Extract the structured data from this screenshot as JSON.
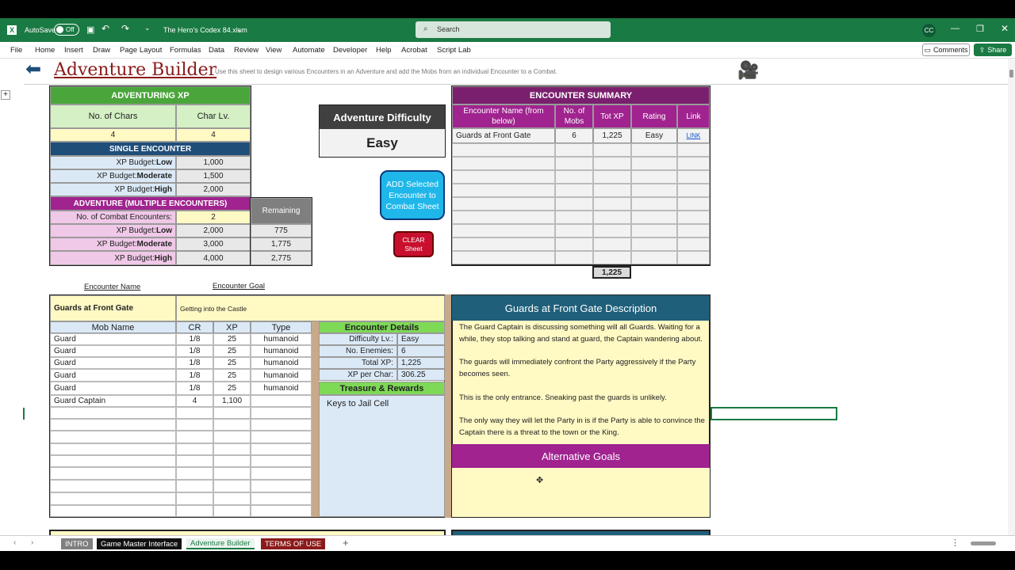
{
  "titlebar": {
    "autosave_label": "AutoSave",
    "toggle_state": "Off",
    "filename": "The Hero's Codex 84.xlsm",
    "search_placeholder": "Search",
    "user_initials": "CC"
  },
  "menu": [
    "File",
    "Home",
    "Insert",
    "Draw",
    "Page Layout",
    "Formulas",
    "Data",
    "Review",
    "View",
    "Automate",
    "Developer",
    "Help",
    "Acrobat",
    "Script Lab"
  ],
  "ribbon_buttons": {
    "comments": "Comments",
    "share": "Share"
  },
  "header": {
    "title": "Adventure Builder",
    "subtitle": "Use this sheet to design various Encounters in an Adventure and add the Mobs from an individual Encounter to a Combat."
  },
  "adventuring_xp": {
    "title": "ADVENTURING XP",
    "col1": "No. of Chars",
    "col2": "Char Lv.",
    "chars": "4",
    "lv": "4",
    "single_title": "SINGLE ENCOUNTER",
    "single": [
      {
        "prefix": "XP Budget: ",
        "level": "Low",
        "value": "1,000"
      },
      {
        "prefix": "XP Budget: ",
        "level": "Moderate",
        "value": "1,500"
      },
      {
        "prefix": "XP Budget: ",
        "level": "High",
        "value": "2,000"
      }
    ],
    "multi_title": "ADVENTURE (MULTIPLE ENCOUNTERS)",
    "remaining_label": "Remaining",
    "combat_label": "No. of Combat Encounters:",
    "combat_value": "2",
    "multi": [
      {
        "prefix": "XP Budget: ",
        "level": "Low",
        "value": "2,000",
        "remaining": "775"
      },
      {
        "prefix": "XP Budget: ",
        "level": "Moderate",
        "value": "3,000",
        "remaining": "1,775"
      },
      {
        "prefix": "XP Budget: ",
        "level": "High",
        "value": "4,000",
        "remaining": "2,775"
      }
    ]
  },
  "difficulty": {
    "title": "Adventure Difficulty",
    "value": "Easy"
  },
  "buttons": {
    "add": "ADD Selected Encounter to Combat Sheet",
    "clear": "CLEAR Sheet"
  },
  "summary": {
    "title": "ENCOUNTER SUMMARY",
    "headers": [
      "Encounter Name (from below)",
      "No. of Mobs",
      "Tot XP",
      "Rating",
      "Link"
    ],
    "rows": [
      {
        "name": "Guards at Front Gate",
        "mobs": "6",
        "xp": "1,225",
        "rating": "Easy",
        "link": "LINK"
      }
    ],
    "total": "1,225"
  },
  "labels": {
    "encounter_name": "Encounter Name",
    "encounter_goal": "Encounter Goal"
  },
  "encounter": {
    "name": "Guards at Front Gate",
    "goal": "Getting into the Castle",
    "mob_headers": [
      "Mob Name",
      "CR",
      "XP",
      "Type"
    ],
    "mobs": [
      {
        "name": "Guard",
        "cr": "1/8",
        "xp": "25",
        "type": "humanoid"
      },
      {
        "name": "Guard",
        "cr": "1/8",
        "xp": "25",
        "type": "humanoid"
      },
      {
        "name": "Guard",
        "cr": "1/8",
        "xp": "25",
        "type": "humanoid"
      },
      {
        "name": "Guard",
        "cr": "1/8",
        "xp": "25",
        "type": "humanoid"
      },
      {
        "name": "Guard",
        "cr": "1/8",
        "xp": "25",
        "type": "humanoid"
      },
      {
        "name": "Guard Captain",
        "cr": "4",
        "xp": "1,100",
        "type": ""
      }
    ],
    "details_title": "Encounter Details",
    "details": [
      {
        "label": "Difficulty Lv.:",
        "value": "Easy"
      },
      {
        "label": "No. Enemies:",
        "value": "6"
      },
      {
        "label": "Total XP:",
        "value": "1,225"
      },
      {
        "label": "XP per Char:",
        "value": "306.25"
      }
    ],
    "treasure_title": "Treasure & Rewards",
    "treasure": "Keys to Jail Cell",
    "desc_title": "Guards at Front Gate Description",
    "desc": [
      "The Guard Captain is discussing something will all Guards. Waiting for a while, they stop talking and stand at guard, the Captain wandering about.",
      "The guards will immediately confront the Party aggressively if the Party becomes seen.",
      "This is the only entrance. Sneaking past the guards is unlikely.",
      "The only way they will let the Party in is if the Party is able to convince the Captain there is a threat to the town or the King."
    ],
    "alt_title": "Alternative Goals"
  },
  "tabs": [
    "INTRO",
    "Game Master Interface",
    "Adventure Builder",
    "TERMS OF USE"
  ],
  "colors": {
    "green": "#4aa63b",
    "blue": "#1f4e79",
    "magenta": "#a0238f",
    "teal": "#1f5f7a",
    "yellow": "#fff9c4",
    "pink": "#f0c8e8",
    "lightblue": "#dbe9f7",
    "lightgreen": "#d4f0c4"
  }
}
